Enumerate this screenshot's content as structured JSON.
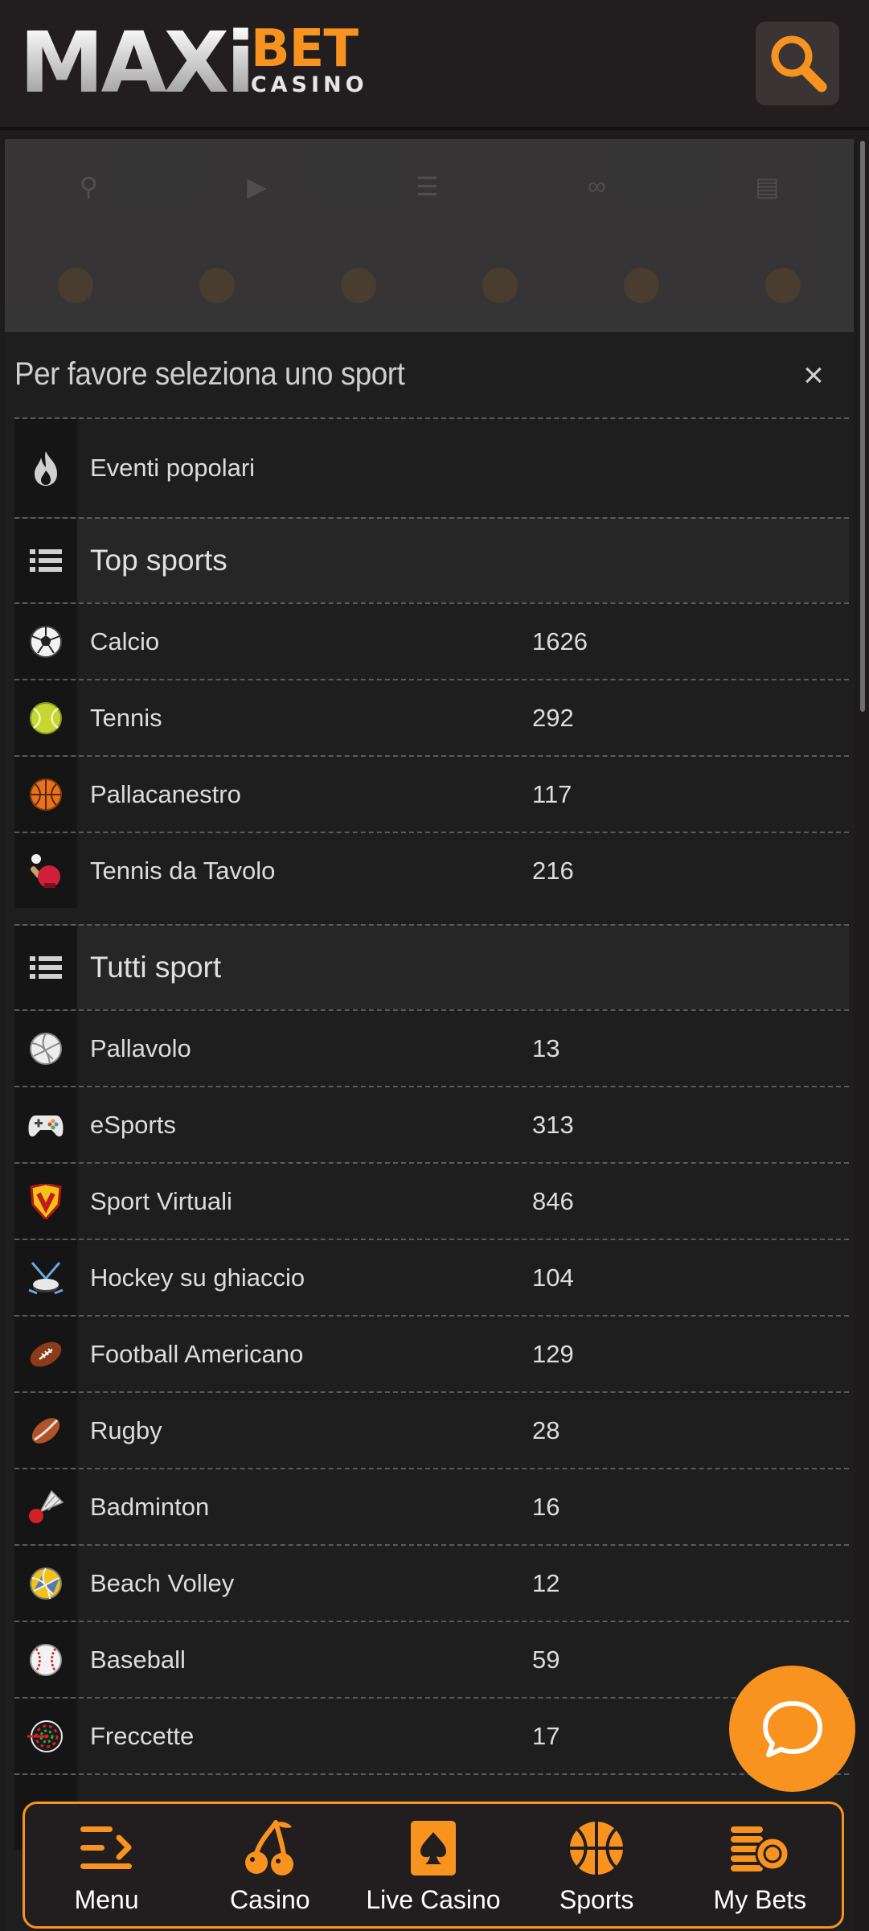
{
  "header": {
    "logo_main": "MAXi",
    "logo_bet": "BET",
    "logo_casino": "CASINO"
  },
  "panel": {
    "title": "Per favore seleziona uno sport",
    "close_symbol": "×",
    "popular": {
      "label": "Eventi popolari",
      "icon": "flame-icon"
    },
    "top_sports": {
      "heading": "Top sports",
      "items": [
        {
          "label": "Calcio",
          "count": "1626",
          "icon": "soccer-ball-icon"
        },
        {
          "label": "Tennis",
          "count": "292",
          "icon": "tennis-ball-icon"
        },
        {
          "label": "Pallacanestro",
          "count": "117",
          "icon": "basketball-icon"
        },
        {
          "label": "Tennis da Tavolo",
          "count": "216",
          "icon": "table-tennis-icon"
        }
      ]
    },
    "all_sports": {
      "heading": "Tutti sport",
      "items": [
        {
          "label": "Pallavolo",
          "count": "13",
          "icon": "volleyball-icon"
        },
        {
          "label": "eSports",
          "count": "313",
          "icon": "gamepad-icon"
        },
        {
          "label": "Sport Virtuali",
          "count": "846",
          "icon": "virtual-sports-icon"
        },
        {
          "label": "Hockey su ghiaccio",
          "count": "104",
          "icon": "ice-hockey-icon"
        },
        {
          "label": "Football Americano",
          "count": "129",
          "icon": "american-football-icon"
        },
        {
          "label": "Rugby",
          "count": "28",
          "icon": "rugby-ball-icon"
        },
        {
          "label": "Badminton",
          "count": "16",
          "icon": "shuttlecock-icon"
        },
        {
          "label": "Beach Volley",
          "count": "12",
          "icon": "beach-volley-icon"
        },
        {
          "label": "Baseball",
          "count": "59",
          "icon": "baseball-icon"
        },
        {
          "label": "Freccette",
          "count": "17",
          "icon": "darts-icon"
        }
      ]
    }
  },
  "bottom_nav": [
    {
      "label": "Menu",
      "icon": "menu-icon"
    },
    {
      "label": "Casino",
      "icon": "cherries-icon"
    },
    {
      "label": "Live Casino",
      "icon": "playing-card-icon"
    },
    {
      "label": "Sports",
      "icon": "basketball-icon"
    },
    {
      "label": "My Bets",
      "icon": "coins-icon"
    }
  ],
  "colors": {
    "accent": "#f7931e",
    "background": "#1e1b1c",
    "panel": "#1e1e1e"
  }
}
